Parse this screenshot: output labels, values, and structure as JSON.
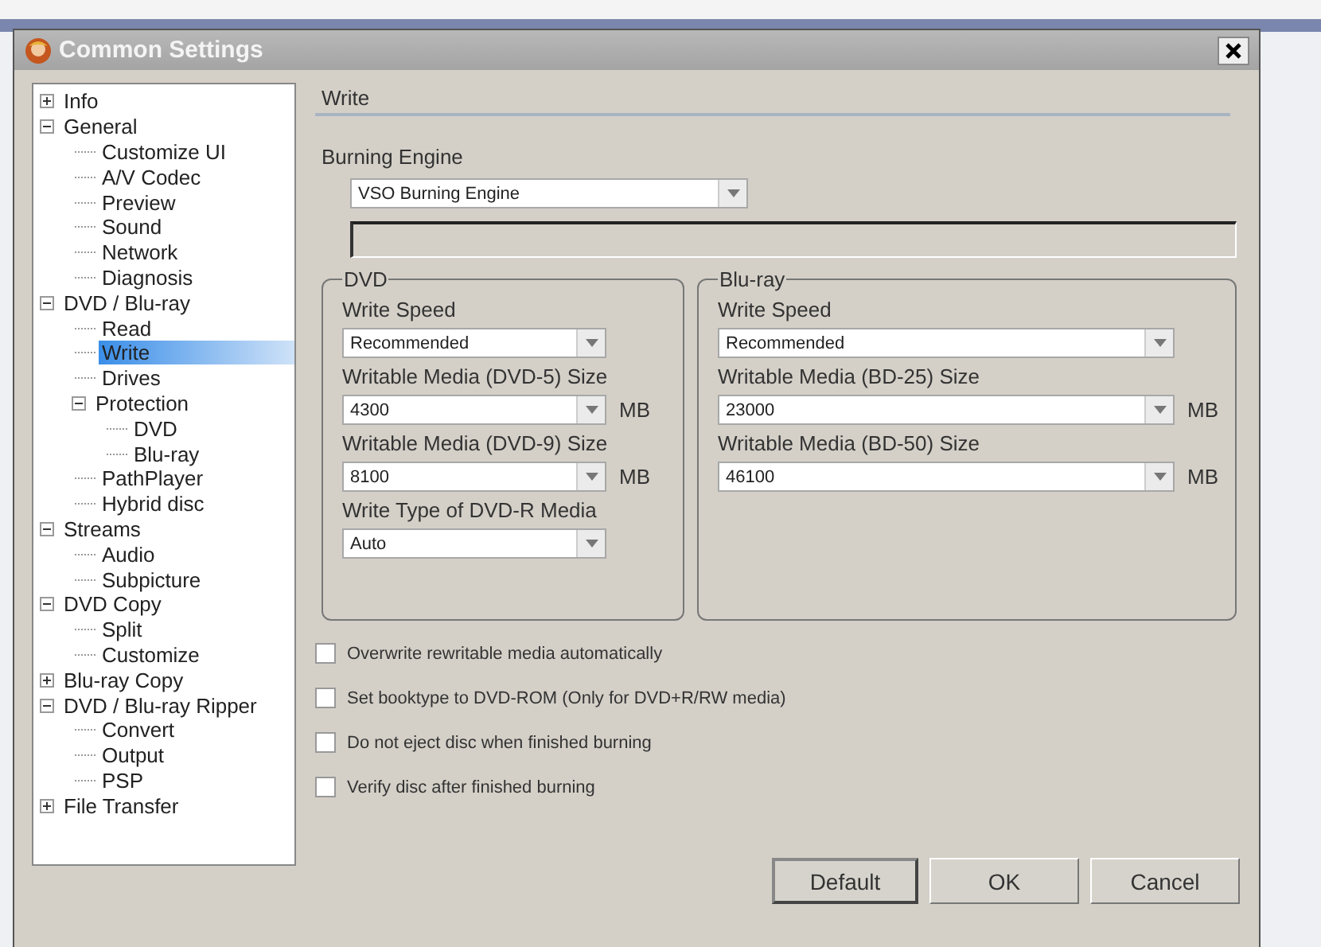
{
  "window": {
    "title": "Common Settings"
  },
  "tree": [
    {
      "label": "Info",
      "expanded": false,
      "selected": false
    },
    {
      "label": "General",
      "expanded": true,
      "selected": false,
      "children": [
        {
          "label": "Customize UI",
          "selected": false
        },
        {
          "label": "A/V Codec",
          "selected": false
        },
        {
          "label": "Preview",
          "selected": false
        },
        {
          "label": "Sound",
          "selected": false
        },
        {
          "label": "Network",
          "selected": false
        },
        {
          "label": "Diagnosis",
          "selected": false
        }
      ]
    },
    {
      "label": "DVD / Blu-ray",
      "expanded": true,
      "selected": false,
      "children": [
        {
          "label": "Read",
          "selected": false
        },
        {
          "label": "Write",
          "selected": true
        },
        {
          "label": "Drives",
          "selected": false
        },
        {
          "label": "Protection",
          "expanded": true,
          "selected": false,
          "children": [
            {
              "label": "DVD",
              "selected": false
            },
            {
              "label": "Blu-ray",
              "selected": false
            }
          ]
        },
        {
          "label": "PathPlayer",
          "selected": false
        },
        {
          "label": "Hybrid disc",
          "selected": false
        }
      ]
    },
    {
      "label": "Streams",
      "expanded": true,
      "selected": false,
      "children": [
        {
          "label": "Audio",
          "selected": false
        },
        {
          "label": "Subpicture",
          "selected": false
        }
      ]
    },
    {
      "label": "DVD Copy",
      "expanded": true,
      "selected": false,
      "children": [
        {
          "label": "Split",
          "selected": false
        },
        {
          "label": "Customize",
          "selected": false
        }
      ]
    },
    {
      "label": "Blu-ray Copy",
      "expanded": false,
      "selected": false
    },
    {
      "label": "DVD / Blu-ray Ripper",
      "expanded": true,
      "selected": false,
      "children": [
        {
          "label": "Convert",
          "selected": false
        },
        {
          "label": "Output",
          "selected": false
        },
        {
          "label": "PSP",
          "selected": false
        }
      ]
    },
    {
      "label": "File Transfer",
      "expanded": false,
      "selected": false
    }
  ],
  "page": {
    "title": "Write",
    "burning_engine": {
      "label": "Burning Engine",
      "value": "VSO Burning Engine"
    },
    "groups": [
      {
        "title": "DVD",
        "fields": [
          {
            "label": "Write Speed",
            "value": "Recommended"
          },
          {
            "label": "Writable Media (DVD-5) Size",
            "value": "4300",
            "unit": "MB"
          },
          {
            "label": "Writable Media (DVD-9) Size",
            "value": "8100",
            "unit": "MB"
          },
          {
            "label": "Write Type of DVD-R Media",
            "value": "Auto"
          }
        ]
      },
      {
        "title": "Blu-ray",
        "fields": [
          {
            "label": "Write Speed",
            "value": "Recommended"
          },
          {
            "label": "Writable Media (BD-25) Size",
            "value": "23000",
            "unit": "MB"
          },
          {
            "label": "Writable Media (BD-50) Size",
            "value": "46100",
            "unit": "MB"
          }
        ]
      }
    ],
    "checkboxes": [
      {
        "label": "Overwrite rewritable media automatically",
        "checked": false
      },
      {
        "label": "Set booktype to DVD-ROM (Only for DVD+R/RW media)",
        "checked": false
      },
      {
        "label": "Do not eject disc when finished burning",
        "checked": false
      },
      {
        "label": "Verify disc after finished burning",
        "checked": false
      }
    ]
  },
  "buttons": [
    {
      "label": "Default",
      "focused": true
    },
    {
      "label": "OK",
      "focused": false
    },
    {
      "label": "Cancel",
      "focused": false
    }
  ]
}
